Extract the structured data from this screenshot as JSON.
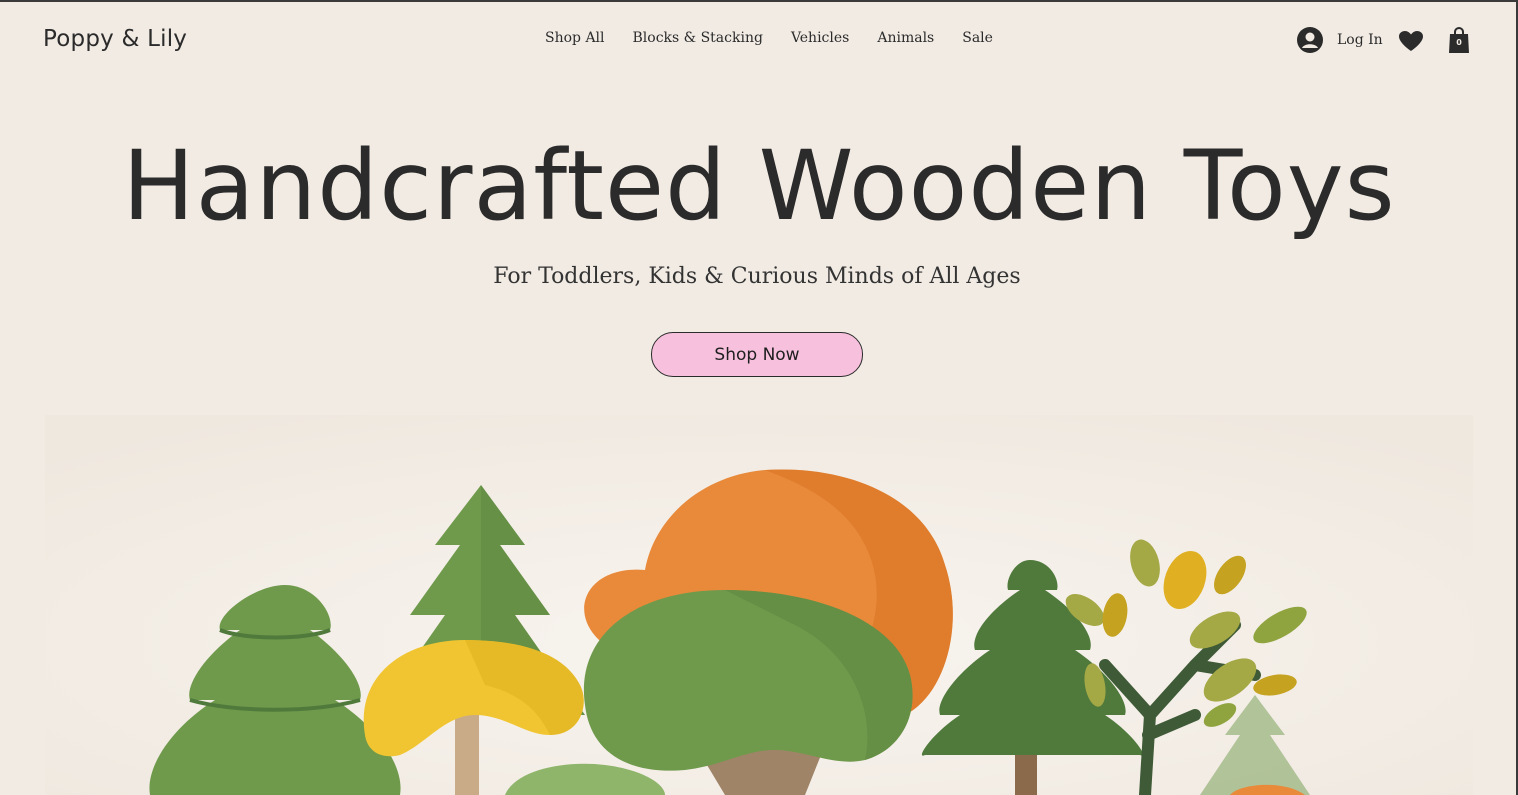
{
  "header": {
    "logo": "Poppy & Lily",
    "nav": [
      {
        "label": "Shop All"
      },
      {
        "label": "Blocks & Stacking"
      },
      {
        "label": "Vehicles"
      },
      {
        "label": "Animals"
      },
      {
        "label": "Sale"
      }
    ],
    "login_label": "Log In",
    "cart_count": "0",
    "icons": [
      "account-icon",
      "heart-icon",
      "shopping-bag-icon"
    ]
  },
  "hero": {
    "title": "Handcrafted Wooden Toys",
    "subtitle": "For Toddlers, Kids & Curious Minds of All Ages",
    "cta_label": "Shop Now",
    "cta_color": "#f7c1dd"
  },
  "colors": {
    "background": "#f2ebe4",
    "text": "#2b2b2b",
    "tree_green": "#6f9a4c",
    "tree_dark_green": "#4f7a3c",
    "tree_orange": "#e88a3a",
    "tree_yellow": "#f1c531"
  }
}
